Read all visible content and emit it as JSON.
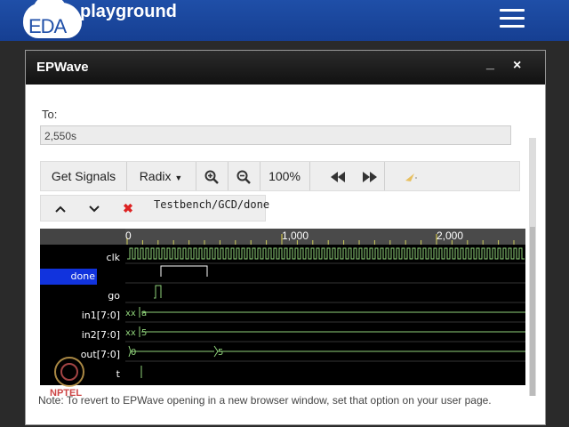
{
  "navbar": {
    "logo_abbr": "EDA",
    "logo_text": "playground",
    "menu_icon": "hamburger-menu-icon",
    "brand_color": "#1f4fa8"
  },
  "window": {
    "title": "EPWave",
    "minimize_label": "_",
    "close_label": "×"
  },
  "to_field": {
    "label": "To:",
    "value": "2,550s"
  },
  "toolbar": {
    "get_signals": "Get Signals",
    "radix": "Radix",
    "zoom_in_icon": "zoom-in-icon",
    "zoom_out_icon": "zoom-out-icon",
    "zoom_level": "100%",
    "prev_edge_icon": "rewind-icon",
    "next_edge_icon": "fast-forward-icon",
    "cursor_icon": "pointer-icon"
  },
  "toolbar2": {
    "move_up_icon": "chevron-up-icon",
    "move_down_icon": "chevron-down-icon",
    "delete_icon": "close-icon",
    "selected_signal_path": "Testbench/GCD/done"
  },
  "waveform": {
    "ruler_labels": [
      "0",
      "1,000",
      "2,000"
    ],
    "signals": [
      {
        "name": "clk",
        "selected": false
      },
      {
        "name": "done",
        "selected": true
      },
      {
        "name": "go",
        "selected": false
      },
      {
        "name": "in1[7:0]",
        "selected": false,
        "values": [
          "xx",
          "a"
        ]
      },
      {
        "name": "in2[7:0]",
        "selected": false,
        "values": [
          "xx",
          "5"
        ]
      },
      {
        "name": "out[7:0]",
        "selected": false,
        "values": [
          "0",
          "5"
        ]
      },
      {
        "name": "t",
        "selected": false
      }
    ],
    "wave_color": "#8fd27a",
    "selection_color": "#1133dd"
  },
  "note": "Note: To revert to EPWave opening in a new browser window, set that option on your user page.",
  "watermark": "NPTEL"
}
